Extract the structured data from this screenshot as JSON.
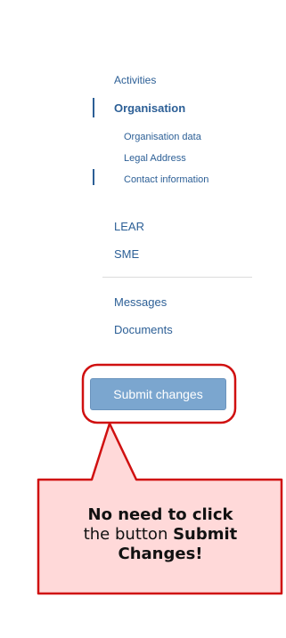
{
  "nav": {
    "activities": "Activities",
    "organisation": "Organisation",
    "organisation_data": "Organisation data",
    "legal_address": "Legal Address",
    "contact_information": "Contact information",
    "lear": "LEAR",
    "sme": "SME",
    "messages": "Messages",
    "documents": "Documents"
  },
  "submit_button": {
    "label": "Submit changes"
  },
  "callout": {
    "line1": "No need to click",
    "line2_prefix": "the button ",
    "line2_bold": "Submit",
    "line3": "Changes!"
  },
  "colors": {
    "link": "#2c5f96",
    "button": "#7ba6cf",
    "callout_fill": "#ffd9d9",
    "callout_border": "#d01010"
  }
}
